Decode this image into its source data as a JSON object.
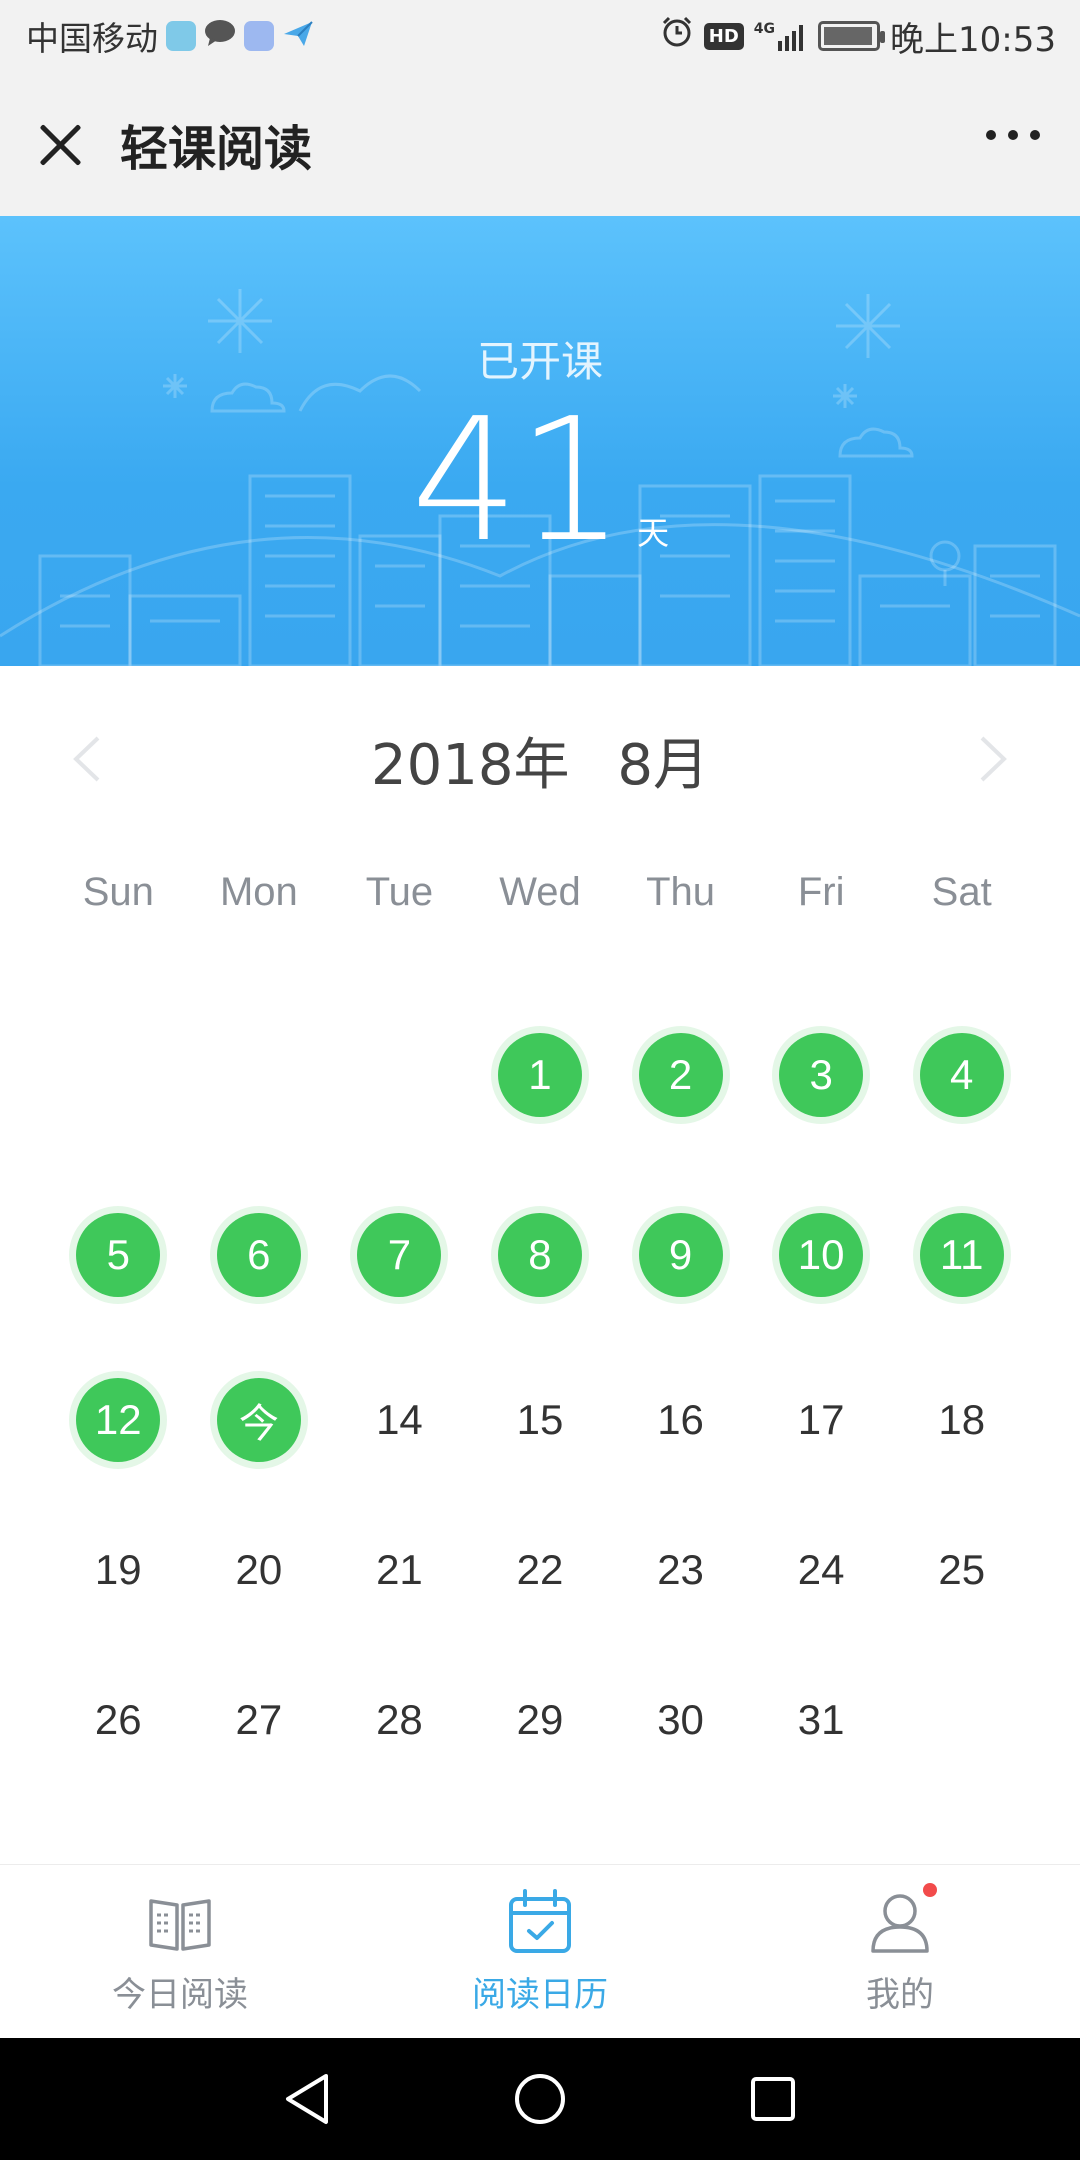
{
  "status_bar": {
    "carrier": "中国移动",
    "time": "晚上10:53",
    "hd_label": "HD",
    "network": "4G",
    "icons": [
      "app-notification-icon",
      "chat-bubble-icon",
      "app-icon",
      "plane-app-icon",
      "alarm-icon",
      "hd-icon",
      "signal-icon",
      "battery-icon"
    ]
  },
  "titlebar": {
    "title": "轻课阅读",
    "close_icon": "close-icon",
    "more_icon": "more-icon"
  },
  "banner": {
    "label": "已开课",
    "days": "41",
    "unit": "天"
  },
  "calendar": {
    "month_label": "2018年 8月",
    "weekdays": [
      "Sun",
      "Mon",
      "Tue",
      "Wed",
      "Thu",
      "Fri",
      "Sat"
    ],
    "weeks": [
      [
        null,
        null,
        null,
        {
          "label": "1",
          "read": true
        },
        {
          "label": "2",
          "read": true
        },
        {
          "label": "3",
          "read": true
        },
        {
          "label": "4",
          "read": true
        }
      ],
      [
        {
          "label": "5",
          "read": true
        },
        {
          "label": "6",
          "read": true
        },
        {
          "label": "7",
          "read": true
        },
        {
          "label": "8",
          "read": true
        },
        {
          "label": "9",
          "read": true
        },
        {
          "label": "10",
          "read": true
        },
        {
          "label": "11",
          "read": true
        }
      ],
      [
        {
          "label": "12",
          "read": true
        },
        {
          "label": "今",
          "read": true,
          "today": true
        },
        {
          "label": "14"
        },
        {
          "label": "15"
        },
        {
          "label": "16"
        },
        {
          "label": "17"
        },
        {
          "label": "18"
        }
      ],
      [
        {
          "label": "19"
        },
        {
          "label": "20"
        },
        {
          "label": "21"
        },
        {
          "label": "22"
        },
        {
          "label": "23"
        },
        {
          "label": "24"
        },
        {
          "label": "25"
        }
      ],
      [
        {
          "label": "26"
        },
        {
          "label": "27"
        },
        {
          "label": "28"
        },
        {
          "label": "29"
        },
        {
          "label": "30"
        },
        {
          "label": "31"
        },
        null
      ]
    ]
  },
  "tabbar": {
    "tabs": [
      {
        "label": "今日阅读",
        "icon": "open-book-icon",
        "active": false
      },
      {
        "label": "阅读日历",
        "icon": "calendar-check-icon",
        "active": true
      },
      {
        "label": "我的",
        "icon": "person-icon",
        "active": false,
        "badge": true
      }
    ]
  },
  "colors": {
    "read_green": "#3fc85a",
    "banner_blue": "#3aa9f1",
    "active_tab": "#3aa9e6",
    "badge_red": "#f24b4b"
  }
}
